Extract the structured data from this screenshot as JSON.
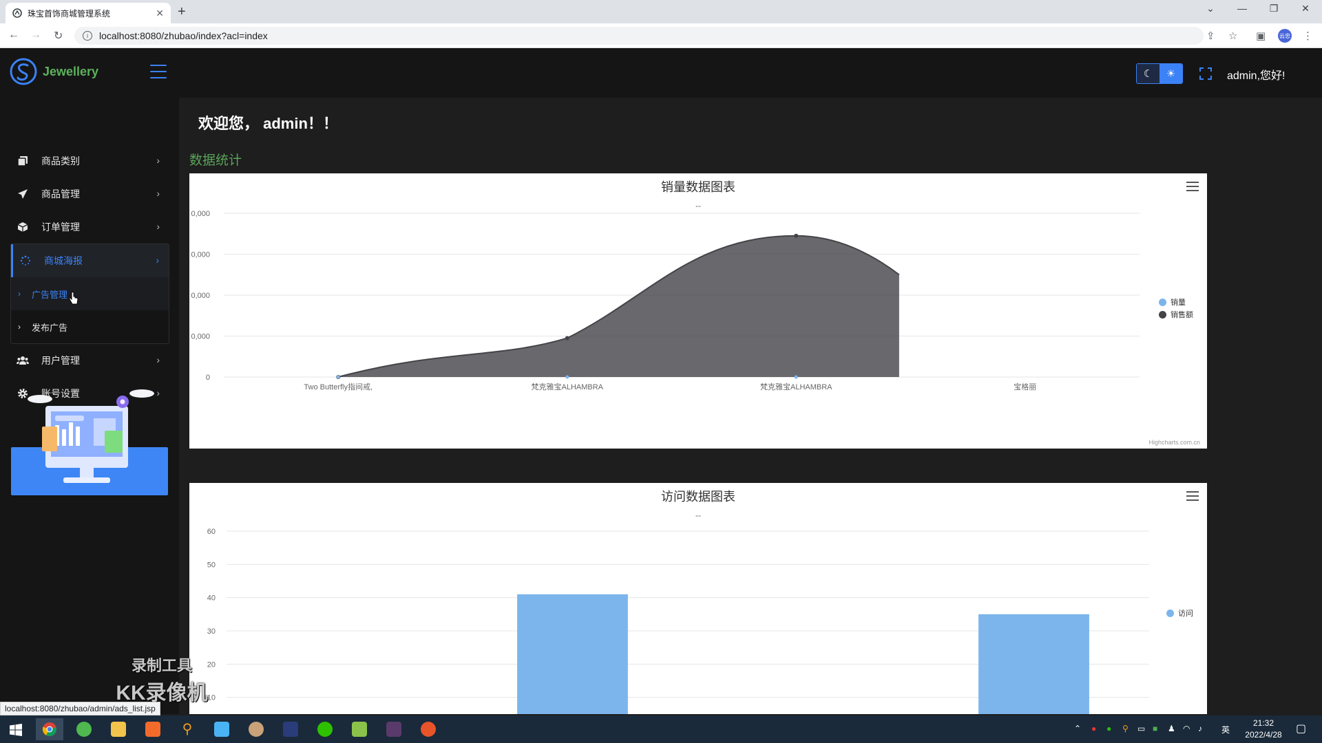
{
  "browser": {
    "tab_title": "珠宝首饰商城管理系统",
    "url": "localhost:8080/zhubao/index?acl=index",
    "profile_label": "云忠",
    "status_url": "localhost:8080/zhubao/admin/ads_list.jsp"
  },
  "app": {
    "logo_text": "Jewellery",
    "greeting": "admin,您好!",
    "welcome": "欢迎您， admin！！",
    "section_title": "数据统计"
  },
  "sidebar": {
    "items": [
      {
        "label": "商品类别",
        "icon": "layers-icon"
      },
      {
        "label": "商品管理",
        "icon": "paper-plane-icon"
      },
      {
        "label": "订单管理",
        "icon": "box-icon"
      },
      {
        "label": "商城海报",
        "icon": "spinner-icon",
        "active": true
      },
      {
        "label": "用户管理",
        "icon": "users-icon"
      },
      {
        "label": "账号设置",
        "icon": "gear-icon"
      }
    ],
    "sub_items": [
      {
        "label": "广告管理",
        "hover": true
      },
      {
        "label": "发布广告"
      }
    ]
  },
  "charts": [
    {
      "title": "销量数据图表",
      "subtitle": "--",
      "credit": "Highcharts.com.cn",
      "legend": [
        {
          "name": "销量",
          "color": "#7cb5ec"
        },
        {
          "name": "销售额",
          "color": "#434348"
        }
      ]
    },
    {
      "title": "访问数据图表",
      "subtitle": "--",
      "legend": [
        {
          "name": "访问",
          "color": "#7cb5ec"
        }
      ]
    }
  ],
  "chart_data": [
    {
      "type": "area",
      "title": "销量数据图表",
      "subtitle": "--",
      "categories": [
        "Two Butterfly指间戒,",
        "梵克雅宝ALHAMBRA",
        "梵克雅宝ALHAMBRA",
        "宝格丽"
      ],
      "ylim": [
        0,
        80000
      ],
      "yticks": [
        "0",
        "0,000",
        "0,000",
        "0,000",
        "0,000"
      ],
      "yticks_values": [
        0,
        20000,
        40000,
        60000,
        80000
      ],
      "series": [
        {
          "name": "销量",
          "values": [
            0,
            0,
            0,
            null
          ],
          "color": "#7cb5ec"
        },
        {
          "name": "销售额",
          "values": [
            0,
            19000,
            69000,
            null
          ],
          "end_value": 50000,
          "color": "#434348"
        }
      ],
      "legend_position": "right",
      "grid": true
    },
    {
      "type": "bar",
      "title": "访问数据图表",
      "subtitle": "--",
      "categories": [
        "",
        "",
        "",
        ""
      ],
      "ylim": [
        0,
        60
      ],
      "yticks": [
        "10",
        "20",
        "30",
        "40",
        "50",
        "60"
      ],
      "yticks_values": [
        10,
        20,
        30,
        40,
        50,
        60
      ],
      "series": [
        {
          "name": "访问",
          "values": [
            null,
            41,
            null,
            35
          ],
          "color": "#7cb5ec"
        }
      ],
      "legend_position": "right",
      "grid": true
    }
  ],
  "watermark": {
    "line1": "录制工具",
    "line2": "KK录像机"
  },
  "taskbar": {
    "time": "21:32",
    "date": "2022/4/28",
    "ime": "英"
  }
}
